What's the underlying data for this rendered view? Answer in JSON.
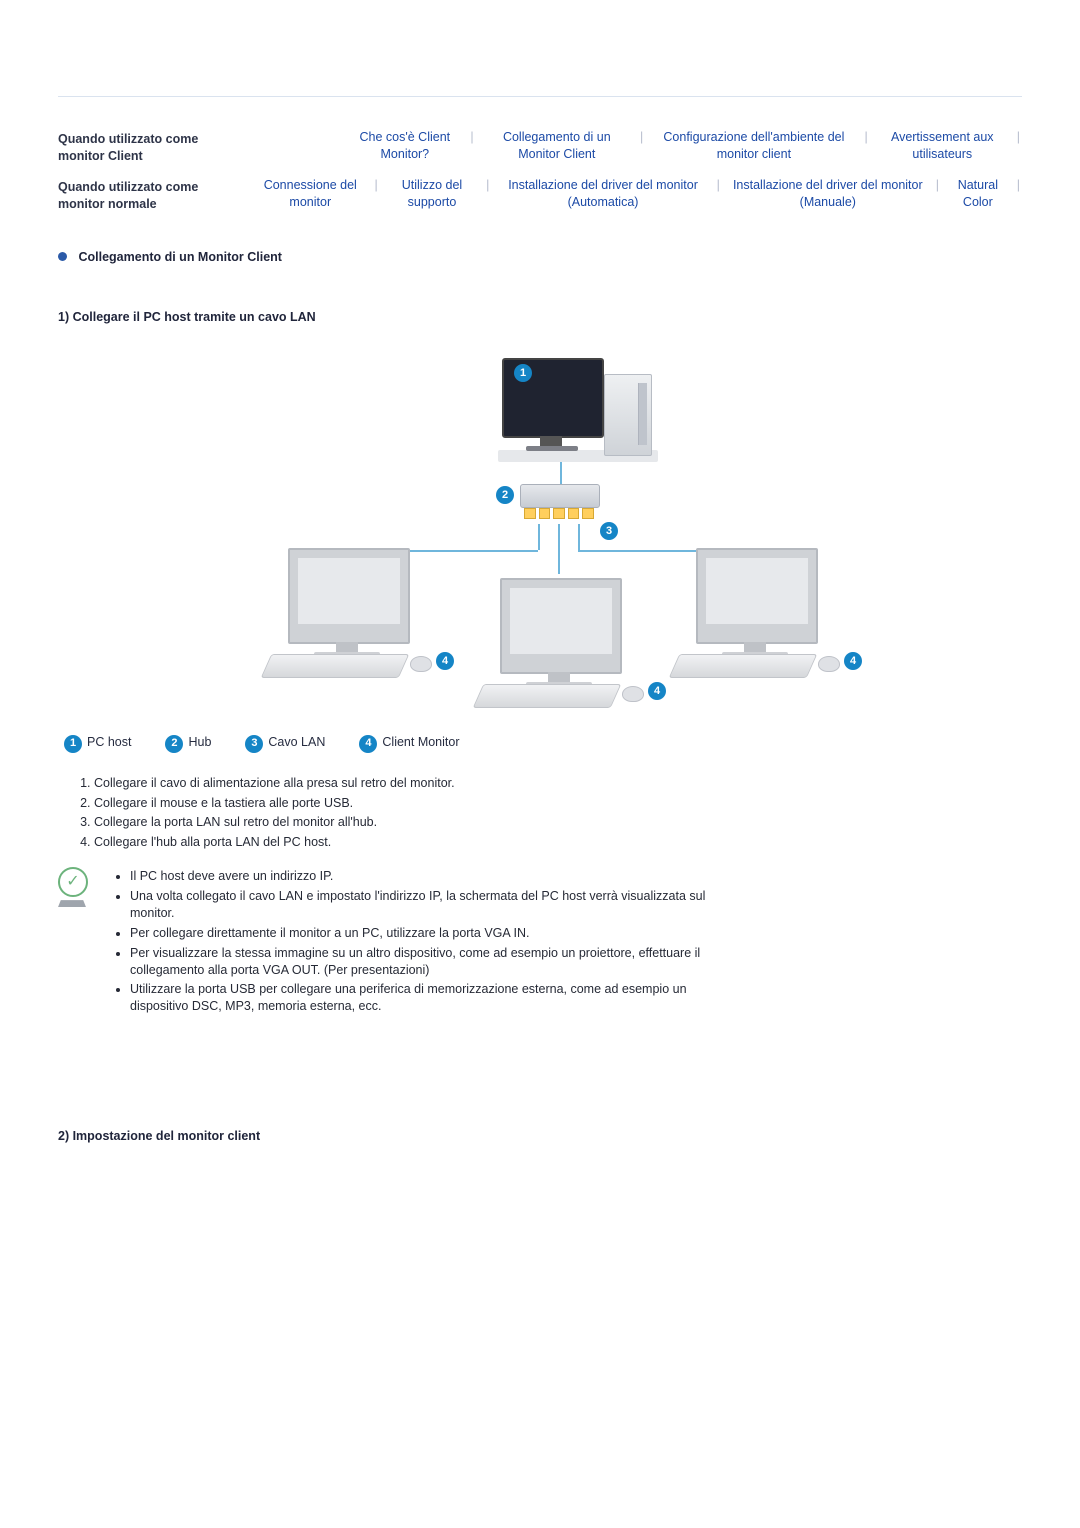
{
  "nav": {
    "row1": {
      "label": "Quando utilizzato come monitor Client",
      "links": [
        "Che cos'è Client Monitor?",
        "Collegamento di un Monitor Client",
        "Configurazione dell'ambiente del monitor client",
        "Avertissement aux utilisateurs"
      ]
    },
    "row2": {
      "label": "Quando utilizzato come monitor normale",
      "links": [
        "Connessione del monitor",
        "Utilizzo del supporto",
        "Installazione del driver del monitor (Automatica)",
        "Installazione del driver del monitor (Manuale)",
        "Natural Color"
      ]
    }
  },
  "section_title": "Collegamento di un Monitor Client",
  "subtitle1": "1) Collegare il PC host tramite un cavo LAN",
  "legend": {
    "1": "PC host",
    "2": "Hub",
    "3": "Cavo LAN",
    "4": "Client Monitor"
  },
  "steps": [
    "Collegare il cavo di alimentazione alla presa sul retro del monitor.",
    "Collegare il mouse e la tastiera alle porte USB.",
    "Collegare la porta LAN sul retro del monitor all'hub.",
    "Collegare l'hub alla porta LAN del PC host."
  ],
  "notes": [
    "Il PC host deve avere un indirizzo IP.",
    "Una volta collegato il cavo LAN e impostato l'indirizzo IP, la schermata del PC host verrà visualizzata sul monitor.",
    "Per collegare direttamente il monitor a un PC, utilizzare la porta VGA IN.",
    "Per visualizzare la stessa immagine su un altro dispositivo, come ad esempio un proiettore, effettuare il collegamento alla porta VGA OUT. (Per presentazioni)",
    "Utilizzare la porta USB per collegare una periferica di memorizzazione esterna, come ad esempio un dispositivo DSC, MP3, memoria esterna, ecc."
  ],
  "subtitle2": "2) Impostazione del monitor client"
}
